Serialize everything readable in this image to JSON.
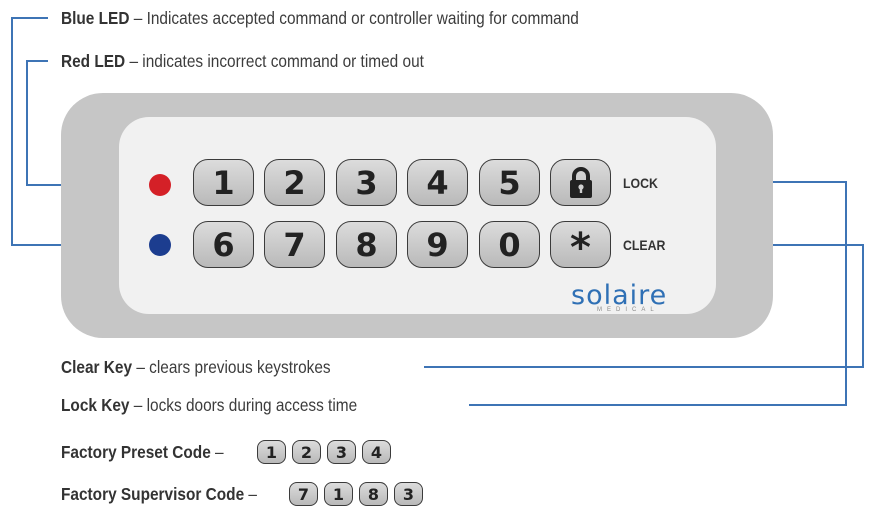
{
  "legend": {
    "blue_led_title": "Blue LED",
    "blue_led_desc": " – Indicates accepted command or controller waiting for command",
    "red_led_title": "Red LED",
    "red_led_desc": " – indicates incorrect command or timed out",
    "clear_key_title": "Clear Key",
    "clear_key_desc": " – clears previous keystrokes",
    "lock_key_title": "Lock Key",
    "lock_key_desc": " – locks doors during access time"
  },
  "keypad": {
    "row1": [
      "1",
      "2",
      "3",
      "4",
      "5"
    ],
    "row2": [
      "6",
      "7",
      "8",
      "9",
      "0"
    ],
    "star": "*",
    "lock_label": "LOCK",
    "clear_label": "CLEAR",
    "brand": "solaire",
    "brand_sub": "MEDICAL"
  },
  "codes": {
    "preset_label": "Factory Preset Code",
    "preset_dash": " –",
    "preset_digits": [
      "1",
      "2",
      "3",
      "4"
    ],
    "supervisor_label": "Factory Supervisor Code",
    "supervisor_dash": " –",
    "supervisor_digits": [
      "7",
      "1",
      "8",
      "3"
    ]
  },
  "colors": {
    "red_led": "#d42027",
    "blue_led": "#1c3d8f",
    "callout_line": "#3e74b5",
    "brand": "#2f70b5"
  }
}
